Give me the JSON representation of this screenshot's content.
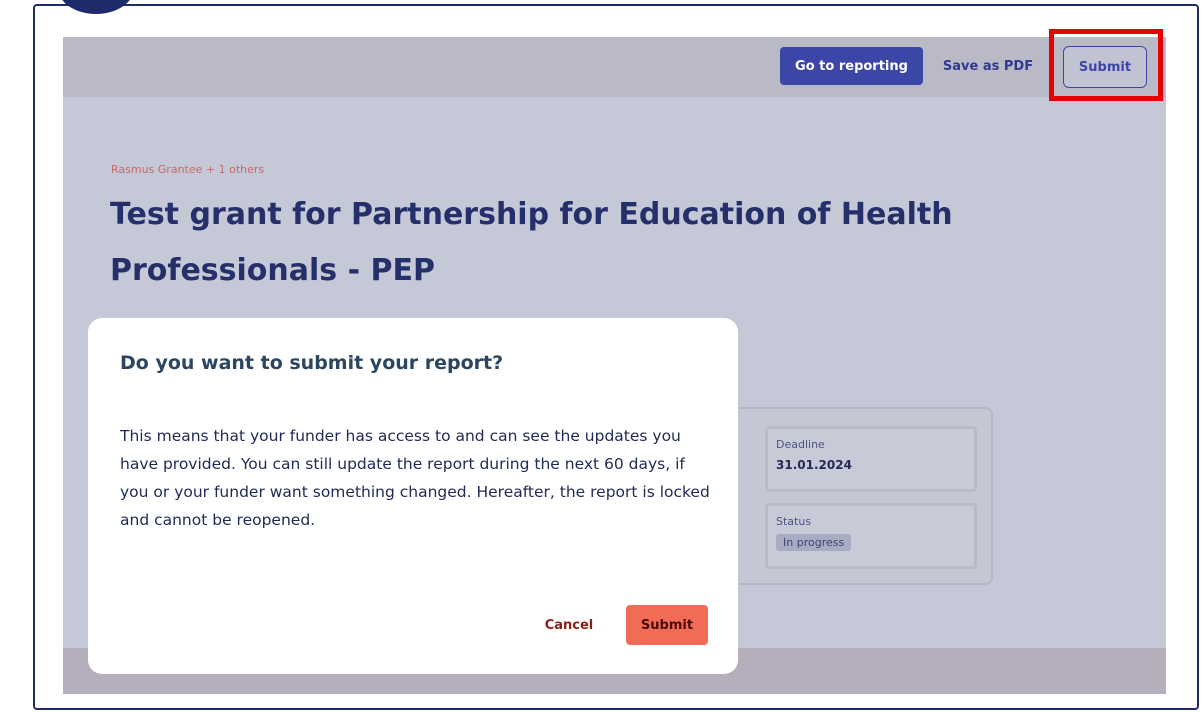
{
  "toolbar": {
    "go_to_reporting_label": "Go to reporting",
    "save_pdf_label": "Save as PDF",
    "submit_label": "Submit"
  },
  "grant": {
    "owner": "Rasmus Grantee + 1 others",
    "title": "Test grant for Partnership for Education of Health Professionals - PEP"
  },
  "info": {
    "deadline_label": "Deadline",
    "deadline_value": "31.01.2024",
    "status_label": "Status",
    "status_value": "In progress"
  },
  "modal": {
    "title": "Do you want to submit your report?",
    "body": "This means that your funder has access to and can see the updates you have provided. You can still update the report during the next 60 days, if you or your funder want something changed. Hereafter, the report is locked and cannot be reopened.",
    "cancel_label": "Cancel",
    "submit_label": "Submit"
  },
  "colors": {
    "primary": "#3b46a6",
    "title": "#25306a",
    "accent_coral": "#f26b57",
    "highlight": "#e60000"
  }
}
